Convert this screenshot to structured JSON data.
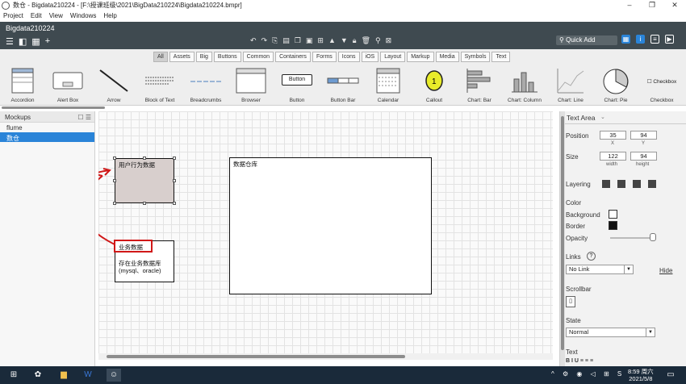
{
  "titlebar": {
    "title": "数仓 - Bigdata210224 - [F:\\授课班级\\2021\\BigData210224\\Bigdata210224.bmpr]",
    "minimize": "–",
    "maximize": "❐",
    "close": "✕"
  },
  "menu": [
    "Project",
    "Edit",
    "View",
    "Windows",
    "Help"
  ],
  "toolbar": {
    "project_name": "Bigdata210224",
    "quick_add": "Quick Add"
  },
  "categories": [
    "All",
    "Assets",
    "Big",
    "Buttons",
    "Common",
    "Containers",
    "Forms",
    "Icons",
    "iOS",
    "Layout",
    "Markup",
    "Media",
    "Symbols",
    "Text"
  ],
  "library": {
    "components": [
      "Accordion",
      "Alert Box",
      "Arrow",
      "Block of Text",
      "Breadcrumbs",
      "Browser",
      "Button",
      "Button Bar",
      "Calendar",
      "Callout",
      "Chart: Bar",
      "Chart: Column",
      "Chart: Line",
      "Chart: Pie",
      "Checkbox"
    ],
    "button_sample": "Button",
    "checkbox_sample": "Checkbox"
  },
  "mockups": {
    "title": "Mockups",
    "items": [
      {
        "label": "flume",
        "selected": false
      },
      {
        "label": "数仓",
        "selected": true
      }
    ]
  },
  "canvas": {
    "user_behavior": "用户行为数据",
    "business_data": "业务数据",
    "business_note": "存在业务数据库\n(mysql、oracle)",
    "warehouse": "数据仓库"
  },
  "props": {
    "title": "Text Area",
    "position_label": "Position",
    "pos_x": "35",
    "pos_y": "94",
    "x_label": "X",
    "y_label": "Y",
    "size_label": "Size",
    "width": "122",
    "height": "94",
    "width_label": "width",
    "height_label": "height",
    "layering_label": "Layering",
    "color_label": "Color",
    "background_label": "Background",
    "border_label": "Border",
    "opacity_label": "Opacity",
    "links_label": "Links",
    "links_help": "?",
    "link_value": "No Link",
    "hide_label": "Hide",
    "scrollbar_label": "Scrollbar",
    "state_label": "State",
    "state_value": "Normal",
    "text_label": "Text"
  },
  "taskbar": {
    "time": "8:59 周六",
    "date": "2021/5/8"
  }
}
